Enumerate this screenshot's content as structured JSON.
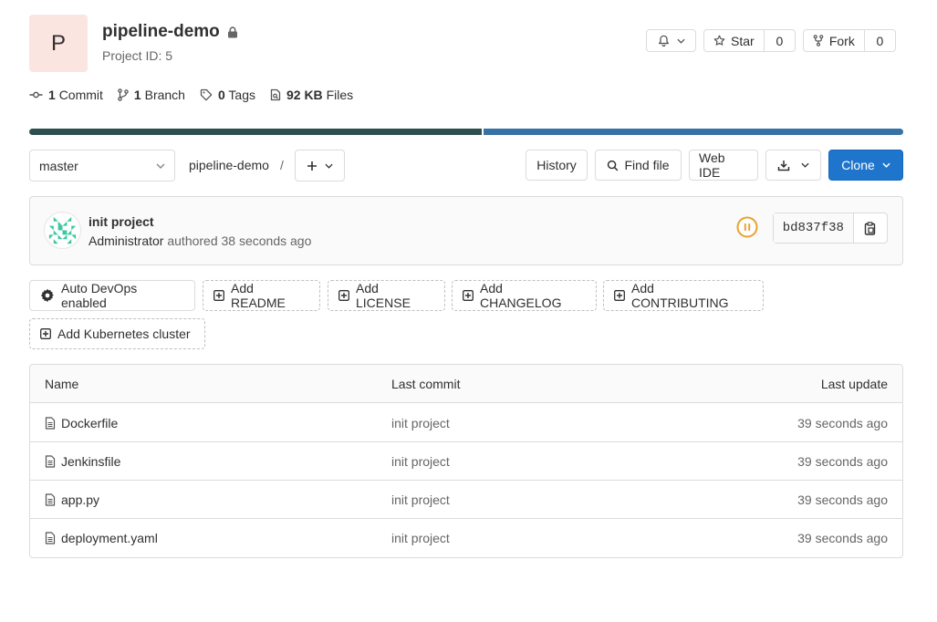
{
  "project": {
    "avatar_letter": "P",
    "name": "pipeline-demo",
    "id_text": "Project ID: 5"
  },
  "header_actions": {
    "star_label": "Star",
    "star_count": "0",
    "fork_label": "Fork",
    "fork_count": "0"
  },
  "stats": {
    "commits_count": "1",
    "commits_label": "Commit",
    "branches_count": "1",
    "branches_label": "Branch",
    "tags_count": "0",
    "tags_label": "Tags",
    "files_size": "92 KB",
    "files_label": "Files"
  },
  "language_bar": {
    "segments": [
      {
        "fraction": 0.518,
        "color": "#2f4f4f"
      },
      {
        "fraction": 0.482,
        "color": "#3572a5"
      }
    ]
  },
  "toolbar": {
    "branch": "master",
    "path_root": "pipeline-demo",
    "separator": "/",
    "history": "History",
    "find_file": "Find file",
    "web_ide": "Web IDE",
    "clone": "Clone"
  },
  "commit": {
    "title": "init project",
    "author": "Administrator",
    "meta": "authored 38 seconds ago",
    "sha": "bd837f38",
    "pipeline_status_color": "#e9a12d"
  },
  "actions": [
    {
      "label": "Auto DevOps enabled",
      "style": "solid",
      "icon": "gear-icon"
    },
    {
      "label": "Add README",
      "style": "dashed",
      "icon": "plus-square-icon"
    },
    {
      "label": "Add LICENSE",
      "style": "dashed",
      "icon": "plus-square-icon"
    },
    {
      "label": "Add CHANGELOG",
      "style": "dashed",
      "icon": "plus-square-icon"
    },
    {
      "label": "Add CONTRIBUTING",
      "style": "dashed",
      "icon": "plus-square-icon"
    },
    {
      "label": "Add Kubernetes cluster",
      "style": "dashed",
      "icon": "plus-square-icon"
    }
  ],
  "table": {
    "headers": {
      "name": "Name",
      "last_commit": "Last commit",
      "last_update": "Last update"
    },
    "rows": [
      {
        "name": "Dockerfile",
        "commit": "init project",
        "updated": "39 seconds ago"
      },
      {
        "name": "Jenkinsfile",
        "commit": "init project",
        "updated": "39 seconds ago"
      },
      {
        "name": "app.py",
        "commit": "init project",
        "updated": "39 seconds ago"
      },
      {
        "name": "deployment.yaml",
        "commit": "init project",
        "updated": "39 seconds ago"
      }
    ]
  },
  "colors": {
    "accent": "#1f75cb",
    "avatar_bg": "#fbe5e1"
  }
}
